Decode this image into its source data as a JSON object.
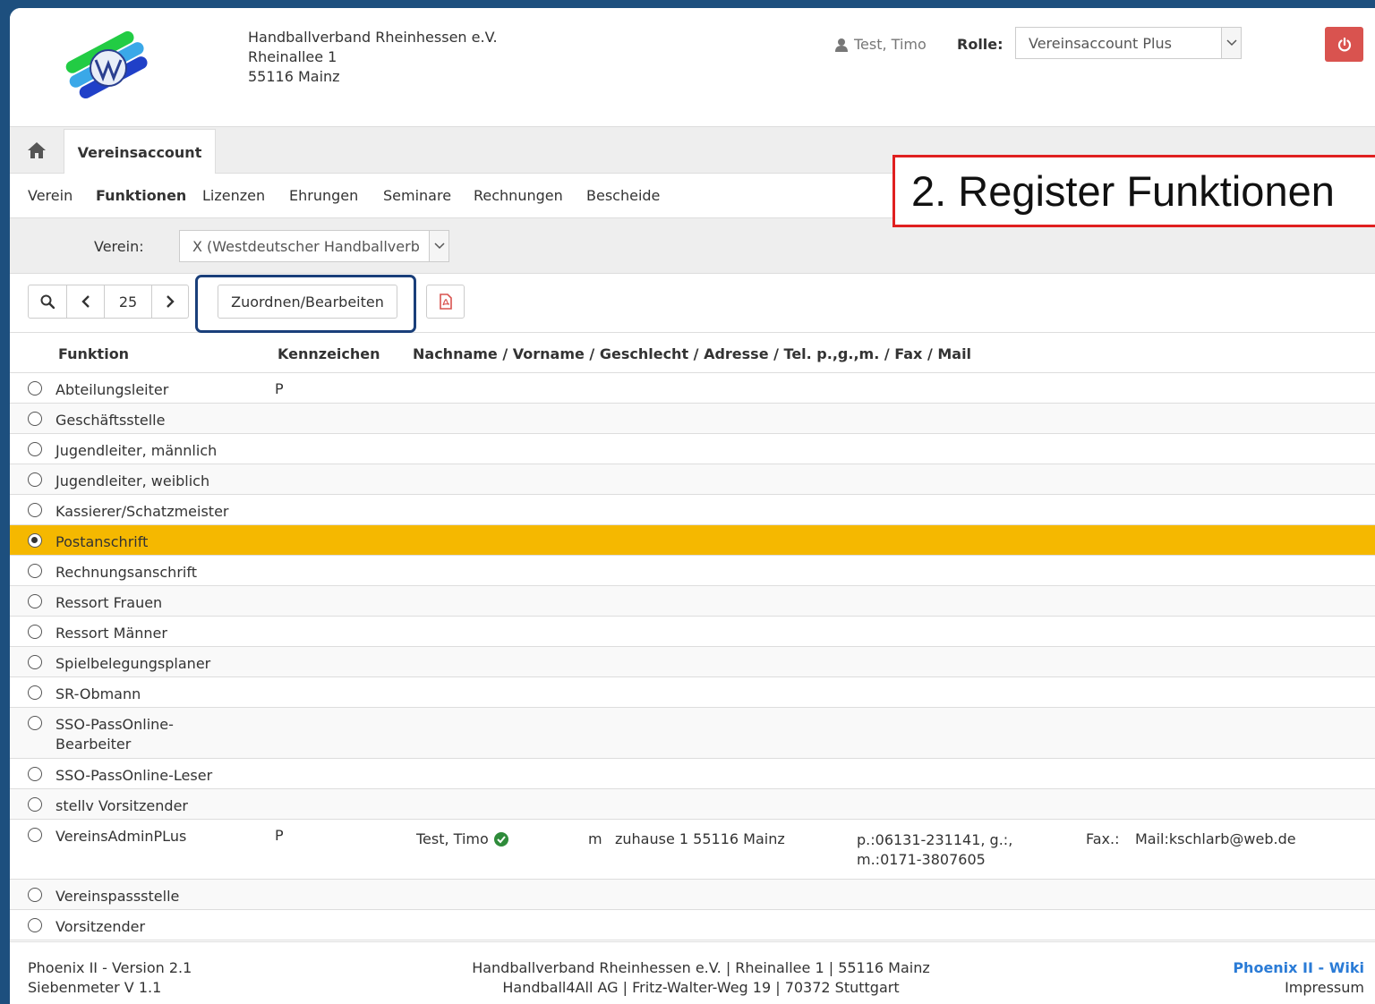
{
  "header": {
    "org_name": "Handballverband Rheinhessen e.V.",
    "org_street": "Rheinallee 1",
    "org_city": "55116 Mainz",
    "user_name": "Test, Timo",
    "role_label": "Rolle:",
    "role_value": "Vereinsaccount Plus"
  },
  "tabs": {
    "main_tab": "Vereinsaccount"
  },
  "subnav": [
    "Verein",
    "Funktionen",
    "Lizenzen",
    "Ehrungen",
    "Seminare",
    "Rechnungen",
    "Bescheide"
  ],
  "annotation": "2. Register Funktionen",
  "filter": {
    "verein_label": "Verein:",
    "verein_value": "X (Westdeutscher Handballverb"
  },
  "toolbar": {
    "page_size": "25",
    "assign_label": "Zuordnen/Bearbeiten"
  },
  "table": {
    "headers": [
      "Funktion",
      "Kennzeichen",
      "Nachname / Vorname / Geschlecht / Adresse / Tel. p.,g.,m. / Fax / Mail"
    ],
    "rows": [
      {
        "funktion": "Abteilungsleiter",
        "kz": "P"
      },
      {
        "funktion": "Geschäftsstelle",
        "kz": ""
      },
      {
        "funktion": "Jugendleiter, männlich",
        "kz": ""
      },
      {
        "funktion": "Jugendleiter, weiblich",
        "kz": ""
      },
      {
        "funktion": "Kassierer/Schatzmeister",
        "kz": ""
      },
      {
        "funktion": "Postanschrift",
        "kz": "",
        "selected": true
      },
      {
        "funktion": "Rechnungsanschrift",
        "kz": ""
      },
      {
        "funktion": "Ressort Frauen",
        "kz": ""
      },
      {
        "funktion": "Ressort Männer",
        "kz": ""
      },
      {
        "funktion": "Spielbelegungsplaner",
        "kz": ""
      },
      {
        "funktion": "SR-Obmann",
        "kz": ""
      },
      {
        "funktion": "SSO-PassOnline-Bearbeiter",
        "kz": ""
      },
      {
        "funktion": "SSO-PassOnline-Leser",
        "kz": ""
      },
      {
        "funktion": "stellv Vorsitzender",
        "kz": ""
      },
      {
        "funktion": "VereinsAdminPLus",
        "kz": "P",
        "person": "Test, Timo",
        "gender": "m",
        "address": "zuhause 1 55116 Mainz",
        "phone": "p.:06131-231141, g.:, m.:0171-3807605",
        "fax": "Fax.:",
        "mail": "Mail:kschlarb@web.de"
      },
      {
        "funktion": "Vereinspassstelle",
        "kz": ""
      },
      {
        "funktion": "Vorsitzender",
        "kz": ""
      }
    ]
  },
  "footer": {
    "version": "Phoenix II - Version 2.1",
    "siebenmeter": "Siebenmeter V 1.1",
    "org_line": "Handballverband Rheinhessen e.V. | Rheinallee 1 | 55116 Mainz",
    "vendor_line": "Handball4All AG | Fritz-Walter-Weg 19 | 70372 Stuttgart",
    "wiki": "Phoenix II - Wiki",
    "impressum": "Impressum"
  },
  "colors": {
    "selected_row": "#f5b800",
    "logout_button": "#d9534f",
    "annotation_border": "#e02020",
    "highlight_border": "#1a3f7a",
    "link": "#2a7bd6"
  }
}
